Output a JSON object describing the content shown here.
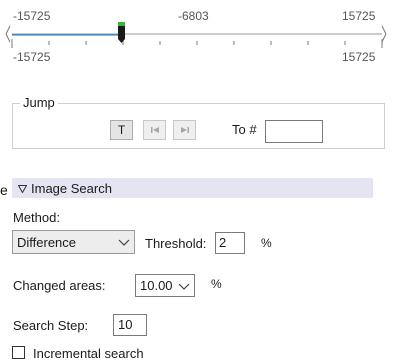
{
  "slider": {
    "top_left": "-15725",
    "top_mid": "-6803",
    "top_right": "15725",
    "bottom_left": "-15725",
    "bottom_right": "15725",
    "value": -6803,
    "min": -15725,
    "max": 15725
  },
  "jump": {
    "group_label": "Jump",
    "t_button": "T",
    "prev_icon": "skip-start-icon",
    "next_icon": "skip-end-icon",
    "to_label": "To #",
    "to_value": ""
  },
  "image_search": {
    "header": "Image Search",
    "header_icon": "collapse-triangle-icon",
    "method_label": "Method:",
    "method_value": "Difference",
    "threshold_label": "Threshold:",
    "threshold_value": "2",
    "threshold_unit": "%",
    "changed_label": "Changed areas:",
    "changed_value": "10.00",
    "changed_unit": "%",
    "step_label": "Search Step:",
    "step_value": "10",
    "incremental_label": "Incremental search",
    "incremental_checked": false,
    "clipped_left": "e"
  },
  "colors": {
    "header_bg": "#e4e4f2",
    "thumb_green": "#3cb43c",
    "accent_line": "#0078d7"
  }
}
